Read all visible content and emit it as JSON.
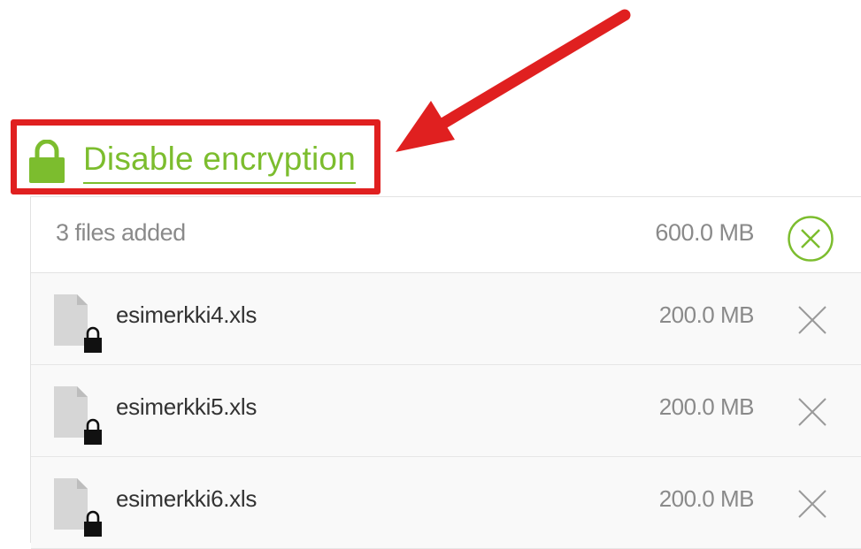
{
  "encryption": {
    "label": "Disable encryption",
    "icon": "lock-icon",
    "color": "#7cbd2e"
  },
  "annotation": {
    "color": "#e02020"
  },
  "summary": {
    "count_text": "3 files added",
    "total_size": "600.0 MB",
    "clear_icon": "circle-close-icon",
    "clear_color": "#7cbd2e"
  },
  "files": [
    {
      "name": "esimerkki4.xls",
      "size": "200.0 MB",
      "icon": "encrypted-file-icon"
    },
    {
      "name": "esimerkki5.xls",
      "size": "200.0 MB",
      "icon": "encrypted-file-icon"
    },
    {
      "name": "esimerkki6.xls",
      "size": "200.0 MB",
      "icon": "encrypted-file-icon"
    }
  ]
}
